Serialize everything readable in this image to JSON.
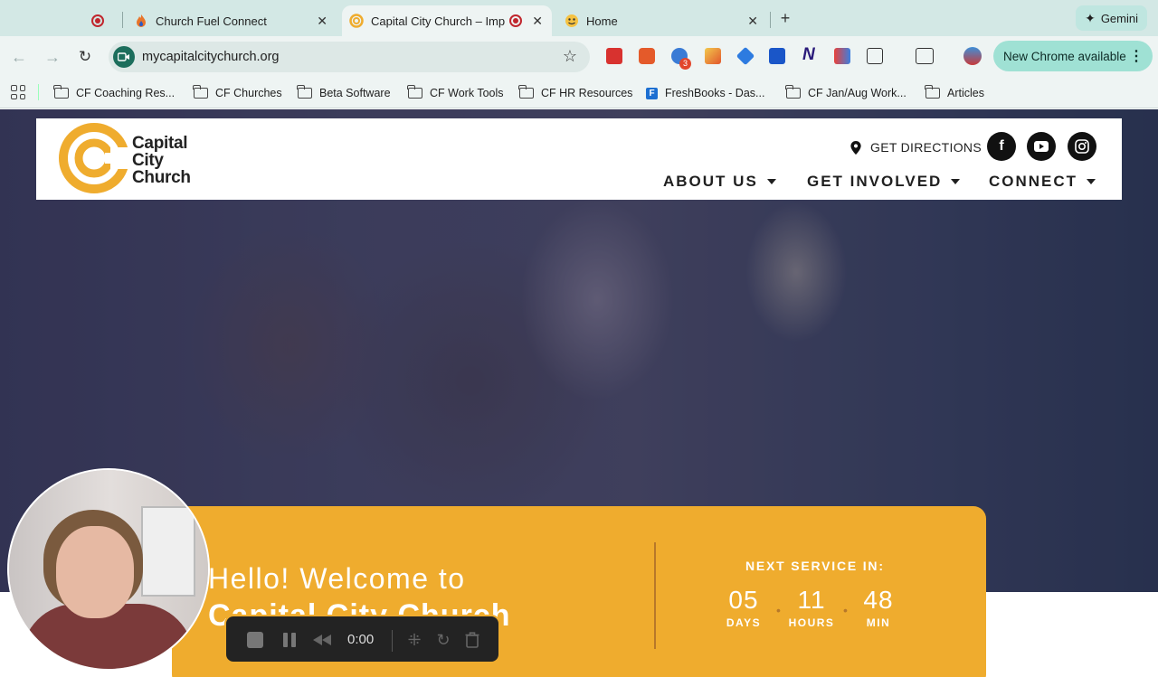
{
  "browser": {
    "tabs": [
      {
        "label": "",
        "icon": "record-icon"
      },
      {
        "label": "Church Fuel Connect",
        "icon": "flame-icon"
      },
      {
        "label": "Capital City Church – Imp",
        "icon": "church-logo-icon"
      },
      {
        "label": "Home",
        "icon": "emoji-icon"
      }
    ],
    "gemini_label": "Gemini",
    "url": "mycapitalcitychurch.org",
    "new_chrome_label": "New Chrome available",
    "extension_badge": "3",
    "bookmarks": [
      "CF Coaching Res...",
      "CF Churches",
      "Beta Software",
      "CF Work Tools",
      "CF HR Resources",
      "FreshBooks - Das...",
      "CF Jan/Aug Work...",
      "Articles"
    ]
  },
  "site": {
    "logo_lines": [
      "Capital",
      "City",
      "Church"
    ],
    "directions_label": "GET DIRECTIONS",
    "nav": [
      "ABOUT US",
      "GET INVOLVED",
      "CONNECT"
    ],
    "social": [
      "facebook-icon",
      "youtube-icon",
      "instagram-icon"
    ],
    "brand_color": "#efac2e",
    "welcome_line1": "Hello! Welcome to",
    "welcome_line2": "Capital City Church",
    "next_service_label": "NEXT SERVICE IN:",
    "countdown": [
      {
        "value": "05",
        "unit": "DAYS"
      },
      {
        "value": "11",
        "unit": "HOURS"
      },
      {
        "value": "48",
        "unit": "MIN"
      }
    ]
  },
  "recorder": {
    "time": "0:00"
  }
}
